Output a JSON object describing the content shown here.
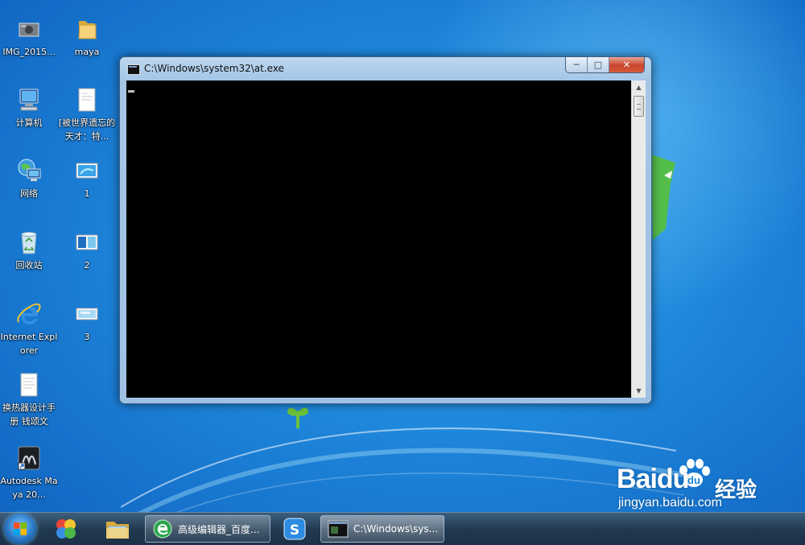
{
  "desktop": {
    "icons": [
      {
        "label": "IMG_2015..."
      },
      {
        "label": "maya"
      },
      {
        "label": "计算机"
      },
      {
        "label": "[被世界遗忘的天才：特..."
      },
      {
        "label": "网络"
      },
      {
        "label": "1"
      },
      {
        "label": "回收站"
      },
      {
        "label": "2"
      },
      {
        "label": "Internet Explorer"
      },
      {
        "label": "3"
      },
      {
        "label": "换热器设计手册 钱颂文"
      },
      {
        "label": "Autodesk Maya 20..."
      }
    ]
  },
  "window": {
    "title": "C:\\Windows\\system32\\at.exe",
    "controls": {
      "minimize": "─",
      "maximize": "□",
      "close": "✕"
    },
    "scroll_up": "▲",
    "scroll_down": "▼"
  },
  "taskbar": {
    "tasks": [
      {
        "label": "高级编辑器_百度..."
      },
      {
        "label": "C:\\Windows\\sys..."
      }
    ]
  },
  "watermark": {
    "brand": "Baidu",
    "jingyan": "经验",
    "url": "jingyan.baidu.com"
  },
  "colors": {
    "desktop_blue": "#1e86db",
    "console_bg": "#000000",
    "close_red": "#c8442c",
    "taskbar": "#20384f"
  }
}
